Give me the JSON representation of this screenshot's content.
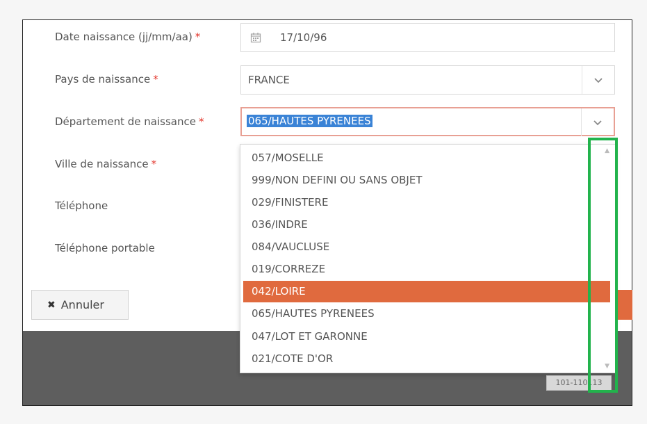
{
  "form": {
    "birth_date": {
      "label": "Date naissance (jj/mm/aa)",
      "required": "*",
      "value": "17/10/96"
    },
    "birth_country": {
      "label": "Pays de naissance",
      "required": "*",
      "value": "FRANCE"
    },
    "birth_department": {
      "label": "Département de naissance",
      "required": "*",
      "value": "065/HAUTES PYRENEES"
    },
    "birth_city": {
      "label": "Ville de naissance",
      "required": "*"
    },
    "phone": {
      "label": "Téléphone"
    },
    "mobile_phone": {
      "label": "Téléphone portable"
    }
  },
  "dropdown": {
    "options": [
      "057/MOSELLE",
      "999/NON DEFINI OU SANS OBJET",
      "029/FINISTERE",
      "036/INDRE",
      "084/VAUCLUSE",
      "019/CORREZE",
      "042/LOIRE",
      "065/HAUTES PYRENEES",
      "047/LOT ET GARONNE",
      "021/COTE D'OR"
    ],
    "highlighted_option": "042/LOIRE"
  },
  "actions": {
    "cancel_label": "Annuler"
  },
  "footer": {
    "reference": "101-110113"
  },
  "colors": {
    "accent": "#e06a3e",
    "selection_blue": "#3a83d6",
    "highlight_green": "#22b34c"
  }
}
